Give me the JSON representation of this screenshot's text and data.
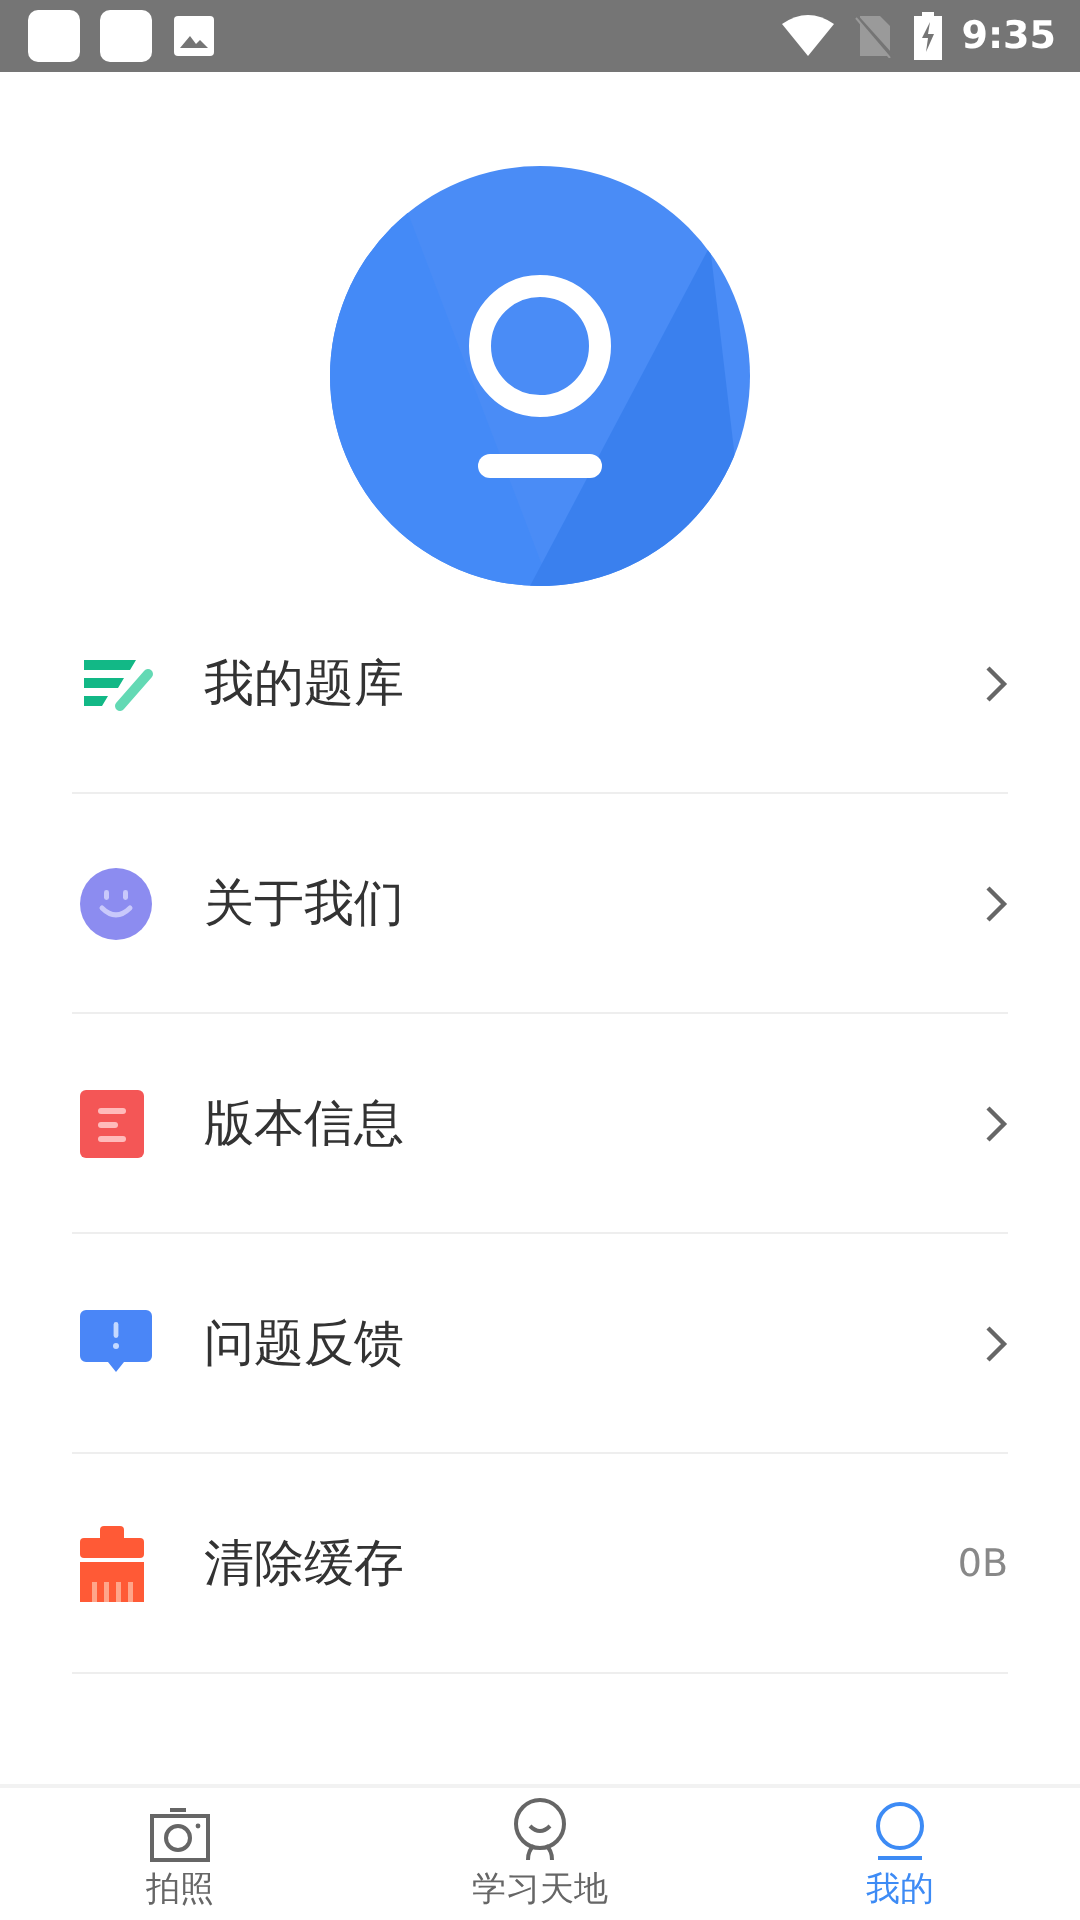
{
  "status_bar": {
    "time": "9:35"
  },
  "menu": [
    {
      "label": "我的题库",
      "kind": "link"
    },
    {
      "label": "关于我们",
      "kind": "link"
    },
    {
      "label": "版本信息",
      "kind": "link"
    },
    {
      "label": "问题反馈",
      "kind": "link"
    },
    {
      "label": "清除缓存",
      "kind": "value",
      "value": "0B"
    }
  ],
  "tabs": [
    {
      "label": "拍照",
      "selected": false
    },
    {
      "label": "学习天地",
      "selected": false
    },
    {
      "label": "我的",
      "selected": true
    }
  ]
}
